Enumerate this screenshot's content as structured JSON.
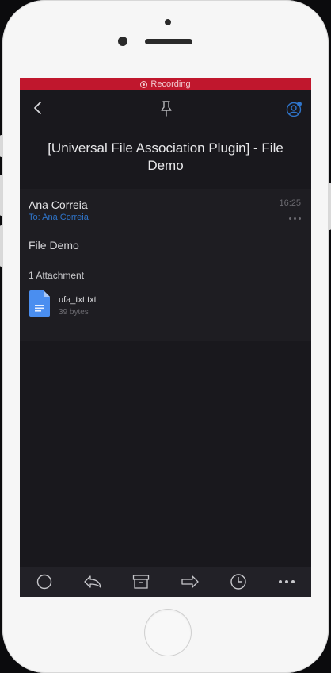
{
  "recording_bar": {
    "label": "Recording"
  },
  "navbar": {
    "back_icon": "chevron-left-icon",
    "pin_icon": "pin-icon",
    "account_icon": "account-icon"
  },
  "message": {
    "subject": "[Universal File Association Plugin] - File Demo",
    "sender": "Ana Correia",
    "recipient": "To: Ana Correia",
    "time": "16:25",
    "body": "File Demo",
    "attachment_count": "1 Attachment",
    "attachment": {
      "name": "ufa_txt.txt",
      "size": "39 bytes",
      "icon": "text-file-icon"
    }
  },
  "toolbar": {
    "items": [
      "circle-icon",
      "reply-icon",
      "archive-icon",
      "forward-icon",
      "clock-icon",
      "more-icon"
    ]
  },
  "colors": {
    "recording": "#c0172d",
    "background": "#19181d",
    "card": "#1e1d22",
    "accent": "#2f74c9"
  }
}
